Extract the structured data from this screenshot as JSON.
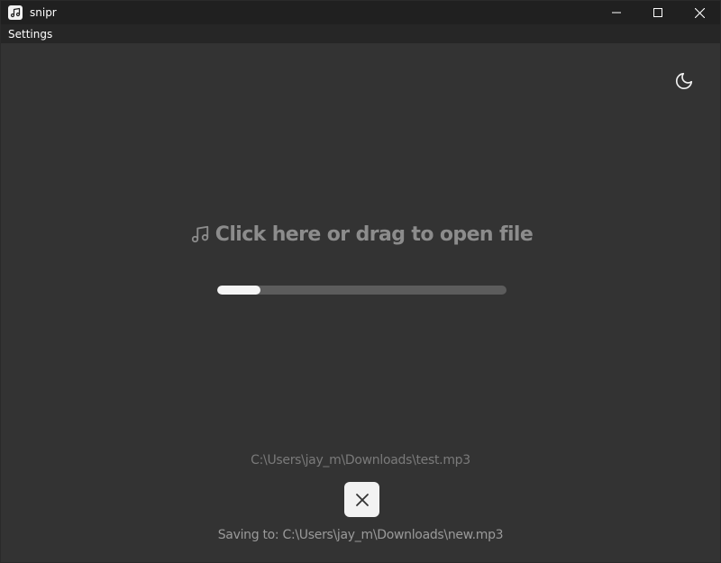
{
  "window": {
    "title": "snipr"
  },
  "menu": {
    "items": [
      {
        "label": "Settings"
      }
    ]
  },
  "dropzone": {
    "label": "Click here or drag to open file"
  },
  "progress": {
    "value_percent": 15
  },
  "file": {
    "source_path": "C:\\Users\\jay_m\\Downloads\\test.mp3",
    "saving_label": "Saving to:",
    "output_path": "C:\\Users\\jay_m\\Downloads\\new.mp3"
  },
  "colors": {
    "background": "#333333",
    "titlebar": "#202020",
    "progress_track": "#5c5c5c",
    "progress_fill": "#f5f5f5"
  },
  "icons": {
    "app": "music-note-icon",
    "theme": "moon-icon",
    "dropzone": "music-note-icon",
    "cancel": "close-icon"
  }
}
